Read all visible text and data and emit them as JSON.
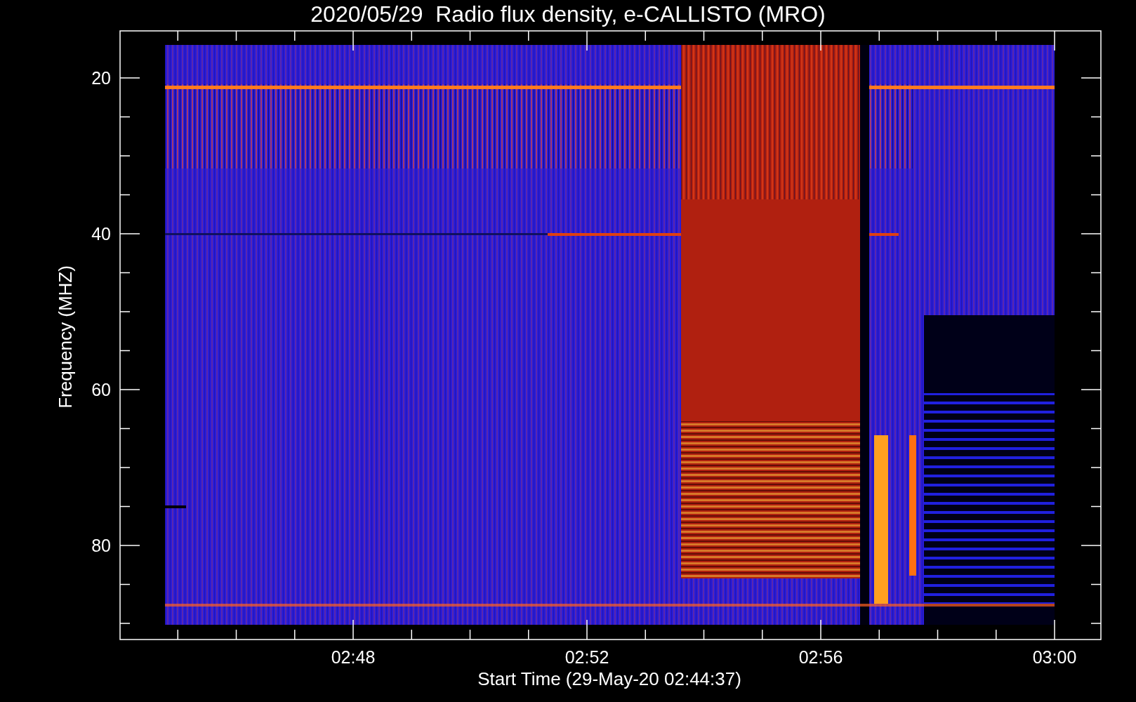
{
  "title": "2020/05/29  Radio flux density, e-CALLISTO (MRO)",
  "y_axis": {
    "label": "Frequency (MHZ)",
    "ticks": [
      "20",
      "40",
      "60",
      "80"
    ]
  },
  "x_axis": {
    "label": "Start Time (29-May-20 02:44:37)",
    "ticks": [
      "02:48",
      "02:52",
      "02:56",
      "03:00"
    ]
  }
}
